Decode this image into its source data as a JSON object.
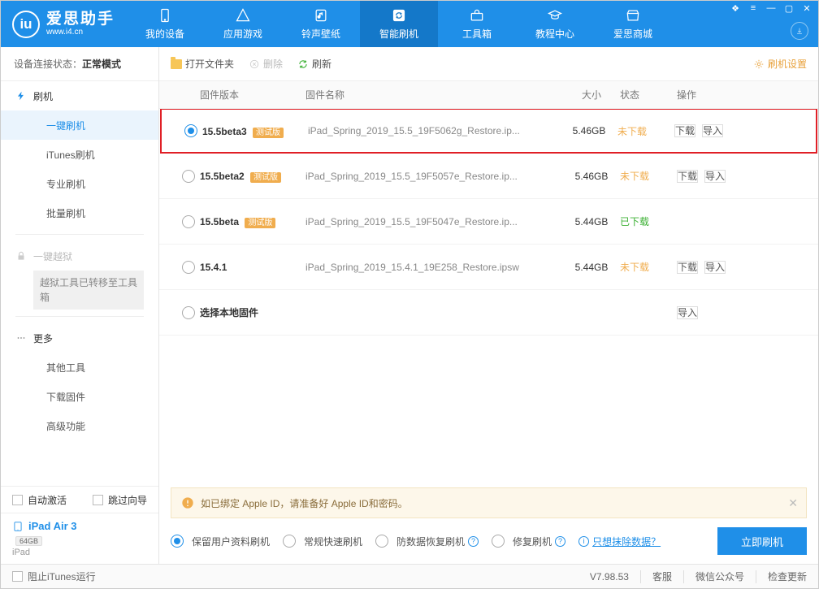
{
  "app": {
    "name": "爱思助手",
    "url": "www.i4.cn"
  },
  "nav": {
    "items": [
      {
        "label": "我的设备"
      },
      {
        "label": "应用游戏"
      },
      {
        "label": "铃声壁纸"
      },
      {
        "label": "智能刷机",
        "active": true
      },
      {
        "label": "工具箱"
      },
      {
        "label": "教程中心"
      },
      {
        "label": "爱思商城"
      }
    ]
  },
  "sidebar": {
    "status_label": "设备连接状态：",
    "status_value": "正常模式",
    "groups": {
      "flash": {
        "head": "刷机",
        "items": [
          "一键刷机",
          "iTunes刷机",
          "专业刷机",
          "批量刷机"
        ]
      },
      "jailbreak": {
        "head": "一键越狱",
        "box": "越狱工具已转移至工具箱"
      },
      "more": {
        "head": "更多",
        "items": [
          "其他工具",
          "下载固件",
          "高级功能"
        ]
      }
    },
    "auto_activate": "自动激活",
    "skip_guide": "跳过向导",
    "device_name": "iPad Air 3",
    "device_capacity": "64GB",
    "device_type": "iPad"
  },
  "toolbar": {
    "open_folder": "打开文件夹",
    "delete": "删除",
    "refresh": "刷新",
    "flash_settings": "刷机设置"
  },
  "table": {
    "headers": {
      "version": "固件版本",
      "name": "固件名称",
      "size": "大小",
      "status": "状态",
      "ops": "操作"
    },
    "rows": [
      {
        "selected": true,
        "version": "15.5beta3",
        "beta": "测试版",
        "name": "iPad_Spring_2019_15.5_19F5062g_Restore.ip...",
        "size": "5.46GB",
        "status": "未下载",
        "status_cls": "orange",
        "download": true,
        "import": true,
        "highlight": true
      },
      {
        "selected": false,
        "version": "15.5beta2",
        "beta": "测试版",
        "name": "iPad_Spring_2019_15.5_19F5057e_Restore.ip...",
        "size": "5.46GB",
        "status": "未下载",
        "status_cls": "orange",
        "download": true,
        "import": true
      },
      {
        "selected": false,
        "version": "15.5beta",
        "beta": "测试版",
        "name": "iPad_Spring_2019_15.5_19F5047e_Restore.ip...",
        "size": "5.44GB",
        "status": "已下载",
        "status_cls": "green",
        "download": false,
        "import": false
      },
      {
        "selected": false,
        "version": "15.4.1",
        "beta": "",
        "name": "iPad_Spring_2019_15.4.1_19E258_Restore.ipsw",
        "size": "5.44GB",
        "status": "未下载",
        "status_cls": "orange",
        "download": true,
        "import": true
      },
      {
        "selected": false,
        "version": "选择本地固件",
        "beta": "",
        "name": "",
        "size": "",
        "status": "",
        "status_cls": "",
        "download": false,
        "import": true
      }
    ],
    "btn_download": "下载",
    "btn_import": "导入"
  },
  "notice": "如已绑定 Apple ID，请准备好 Apple ID和密码。",
  "options": {
    "keep_data": "保留用户资料刷机",
    "normal_fast": "常规快速刷机",
    "anti_data": "防数据恢复刷机",
    "repair": "修复刷机",
    "erase_link": "只想抹除数据？",
    "flash_now": "立即刷机"
  },
  "status": {
    "block_itunes": "阻止iTunes运行",
    "version": "V7.98.53",
    "service": "客服",
    "wechat": "微信公众号",
    "check_update": "检查更新"
  }
}
